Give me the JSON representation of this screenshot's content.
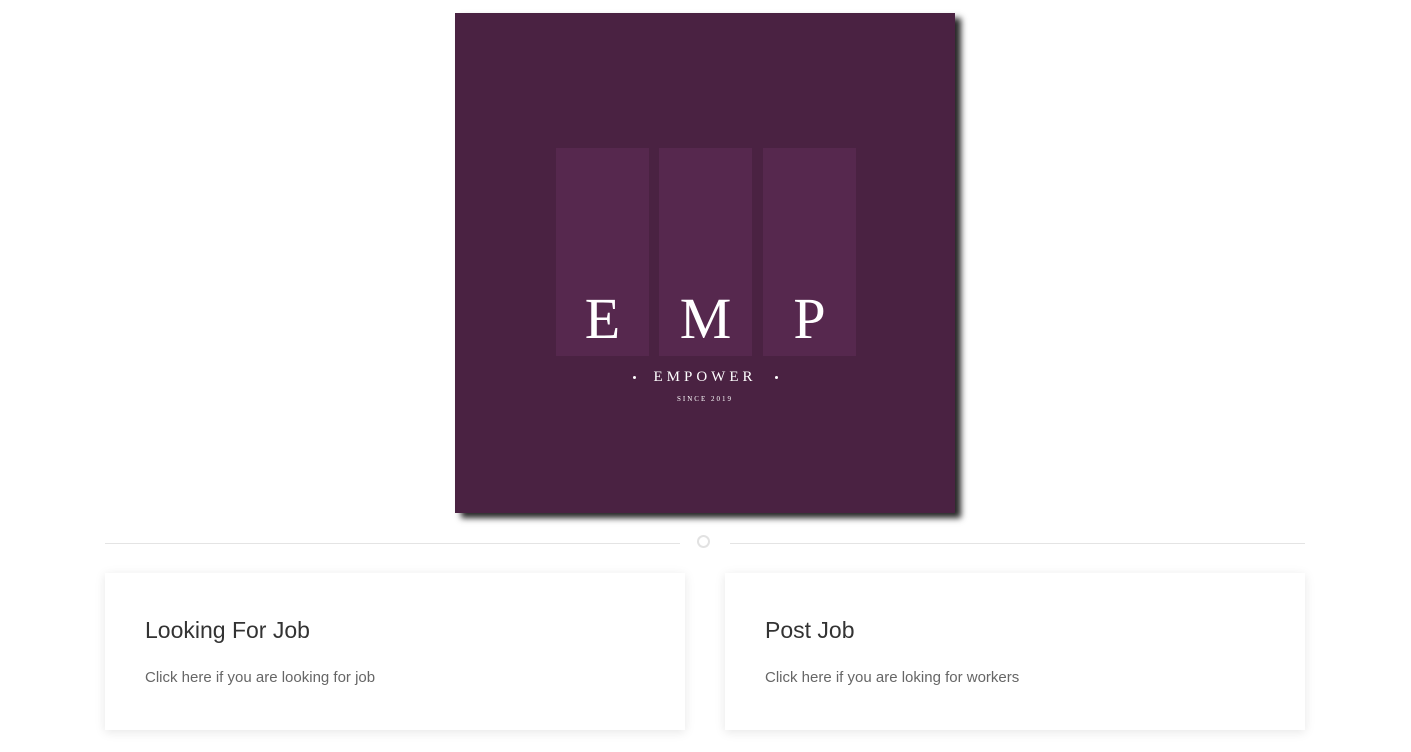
{
  "logo": {
    "letters": [
      "E",
      "M",
      "P"
    ],
    "brand": "EMPOWER",
    "since": "SINCE 2019",
    "colors": {
      "background": "#4a2242",
      "bars": "#56284e",
      "text": "#ffffff"
    }
  },
  "cards": [
    {
      "title": "Looking For Job",
      "text": "Click here if you are looking for job"
    },
    {
      "title": "Post Job",
      "text": "Click here if you are loking for workers"
    }
  ]
}
